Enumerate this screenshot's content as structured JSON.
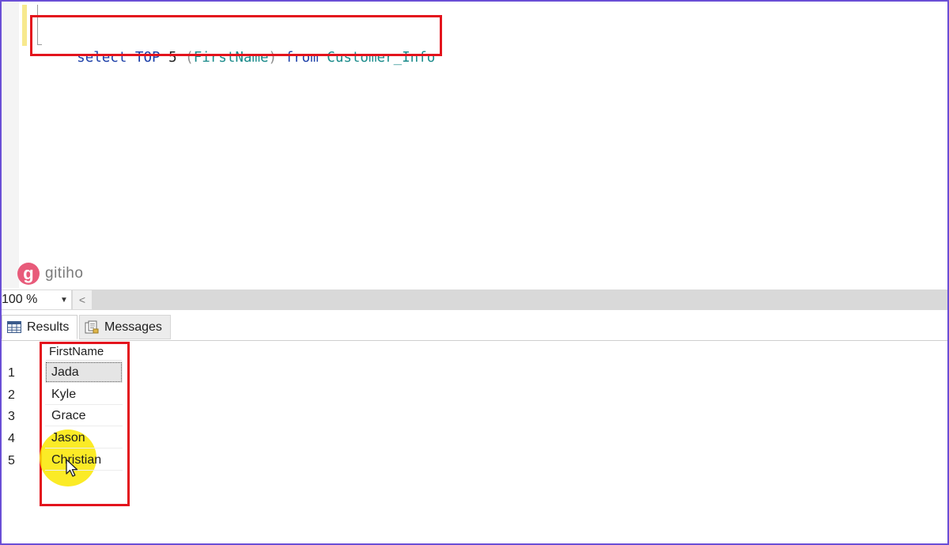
{
  "editor": {
    "query_tokens": [
      {
        "text": "select",
        "role": "keyword"
      },
      {
        "text": " TOP ",
        "role": "keyword"
      },
      {
        "text": "5 ",
        "role": "plain"
      },
      {
        "text": "(",
        "role": "paren"
      },
      {
        "text": "FirstName",
        "role": "identifier"
      },
      {
        "text": ")",
        "role": "paren"
      },
      {
        "text": " from ",
        "role": "keyword"
      },
      {
        "text": "Customer_Info",
        "role": "identifier"
      }
    ]
  },
  "watermark": {
    "logo_letter": "g",
    "logo_text": "gitiho"
  },
  "zoombar": {
    "zoom_value": "100 %",
    "dropdown_glyph": "▼",
    "scroll_left_glyph": "<"
  },
  "result_tabs": {
    "results_label": "Results",
    "messages_label": "Messages"
  },
  "results_grid": {
    "columns": [
      "FirstName"
    ],
    "rows": [
      {
        "num": "1",
        "FirstName": "Jada"
      },
      {
        "num": "2",
        "FirstName": "Kyle"
      },
      {
        "num": "3",
        "FirstName": "Grace"
      },
      {
        "num": "4",
        "FirstName": "Jason"
      },
      {
        "num": "5",
        "FirstName": "Christian"
      }
    ],
    "selected_row": 1
  },
  "colors": {
    "keyword": "#1c3fa8",
    "identifier": "#1a8a8a",
    "paren": "#8c8c8c",
    "callout": "#e3141d",
    "cursor_highlight": "#fae800",
    "frame": "#6a4fd6",
    "logo": "#e85b7a"
  }
}
